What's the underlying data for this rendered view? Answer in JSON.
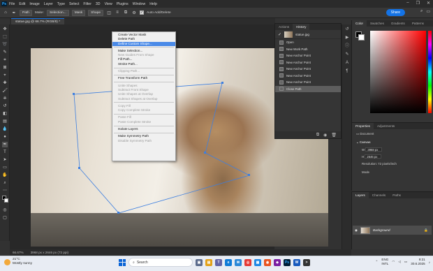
{
  "menubar": {
    "logo": "Ps",
    "items": [
      "File",
      "Edit",
      "Image",
      "Layer",
      "Type",
      "Select",
      "Filter",
      "3D",
      "View",
      "Plugins",
      "Window",
      "Help"
    ],
    "window_controls": [
      "–",
      "❐",
      "✕"
    ]
  },
  "options": {
    "mode_value": "Path",
    "make_label": "Make:",
    "selection_btn": "Selection...",
    "mask_btn": "Mask",
    "shape_btn": "Shape",
    "auto_add_delete": "Auto Add/Delete",
    "share_btn": "Share"
  },
  "doc_tab": {
    "label": "statue.jpg @ 66.7% (RGB/8) *"
  },
  "context_menu": {
    "groups": [
      [
        "Create Vector Mask",
        "Delete Path"
      ],
      [
        "Define Custom Shape..."
      ],
      [
        "Make Selection...",
        "New Guides From Shape",
        "Fill Path...",
        "Stroke Path..."
      ],
      [
        "Clipping Path..."
      ],
      [
        "Free Transform Path"
      ],
      [
        "Unite Shapes",
        "Subtract Front Shape",
        "Unite Shapes at Overlap",
        "Subtract Shapes at Overlap"
      ],
      [
        "Copy Fill",
        "Copy Complete Stroke"
      ],
      [
        "Paste Fill",
        "Paste Complete Stroke"
      ],
      [
        "Isolate Layers"
      ],
      [
        "Make Symmetry Path",
        "Disable Symmetry Path"
      ]
    ],
    "highlighted": "Define Custom Shape..."
  },
  "history": {
    "tabs": [
      "Actions",
      "History"
    ],
    "snapshot": "statue.jpg",
    "states": [
      "Open",
      "New Work Path",
      "New Anchor Point",
      "New Anchor Point",
      "New Anchor Point",
      "New Anchor Point",
      "New Anchor Point",
      "Close Path"
    ]
  },
  "color_panel": {
    "tabs": [
      "Color",
      "Swatches",
      "Gradients",
      "Patterns"
    ],
    "foreground": "#000000",
    "background": "#ffffff"
  },
  "properties": {
    "tabs": [
      "Properties",
      "Adjustments"
    ],
    "doc_label": "Document",
    "canvas_label": "Canvas",
    "w_label": "W",
    "w_value": "3968 px",
    "h_label": "H",
    "h_value": "2646 px",
    "resolution": "Resolution: 72 pixels/inch",
    "mode_label": "Mode"
  },
  "layers": {
    "tabs": [
      "Layers",
      "Channels",
      "Paths"
    ],
    "layer_name": "Background"
  },
  "status": {
    "zoom": "66.67%",
    "doc_size": "3968 px x 2646 px (72 ppi)"
  },
  "taskbar": {
    "temp": "21°C",
    "weather": "Mostly sunny",
    "search_placeholder": "Search",
    "lang1": "ENG",
    "lang2": "INTL",
    "time": "9:21",
    "date": "30.6.2025"
  }
}
